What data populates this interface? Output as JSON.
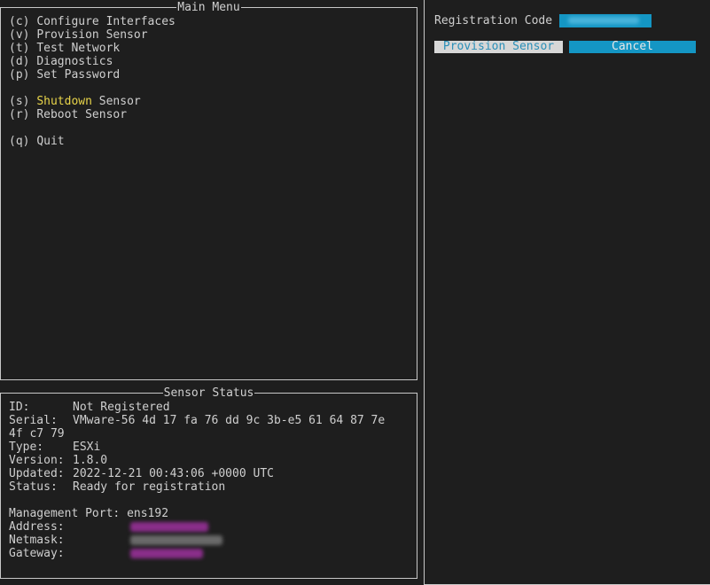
{
  "main_menu": {
    "title": "Main Menu",
    "items": [
      {
        "key": "(c)",
        "label": "Configure Interfaces"
      },
      {
        "key": "(v)",
        "label": "Provision Sensor"
      },
      {
        "key": "(t)",
        "label": "Test Network"
      },
      {
        "key": "(d)",
        "label": "Diagnostics"
      },
      {
        "key": "(p)",
        "label": "Set Password"
      },
      {
        "key": "(s)",
        "label_highlight": "Shutdown",
        "label_rest": " Sensor"
      },
      {
        "key": "(r)",
        "label": "Reboot Sensor"
      },
      {
        "key": "(q)",
        "label": "Quit"
      }
    ]
  },
  "sensor_status": {
    "title": "Sensor Status",
    "id_label": "ID:",
    "id_value": "Not Registered",
    "serial_label": "Serial:",
    "serial_value": "VMware-56 4d 17 fa 76 dd 9c 3b-e5 61 64 87 7e",
    "serial_value_cont": "4f c7 79",
    "type_label": "Type:",
    "type_value": "ESXi",
    "version_label": "Version:",
    "version_value": "1.8.0",
    "updated_label": "Updated:",
    "updated_value": "2022-12-21 00:43:06 +0000 UTC",
    "status_label": "Status:",
    "status_value": "Ready for registration",
    "mgmt_label": "Management Port:",
    "mgmt_value": "ens192",
    "address_label": "Address:",
    "netmask_label": "Netmask:",
    "gateway_label": "Gateway:"
  },
  "provision": {
    "registration_label": "Registration Code",
    "provision_button": "Provision Sensor",
    "cancel_button": "Cancel"
  },
  "colors": {
    "highlight": "#e8d44a",
    "accent": "#1496c4",
    "background": "#1e1e1e"
  }
}
